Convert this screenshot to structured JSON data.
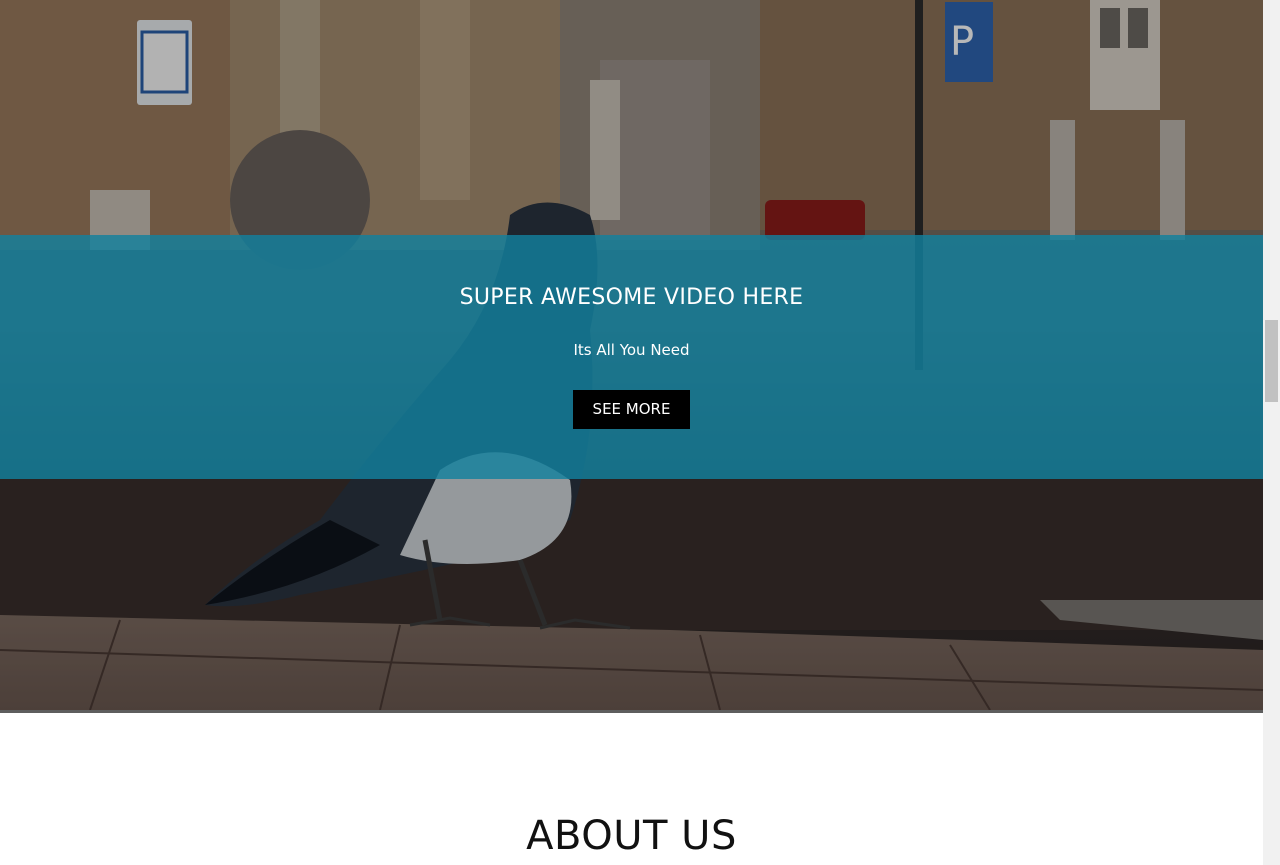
{
  "hero": {
    "title": "SUPER AWESOME VIDEO HERE",
    "subtitle": "Its All You Need",
    "button_label": "SEE MORE",
    "overlay_color": "#12809e",
    "button_color": "#000000"
  },
  "about": {
    "title": "ABOUT US"
  },
  "colors": {
    "background": "#ffffff",
    "text_dark": "#111111",
    "text_light": "#ffffff"
  }
}
